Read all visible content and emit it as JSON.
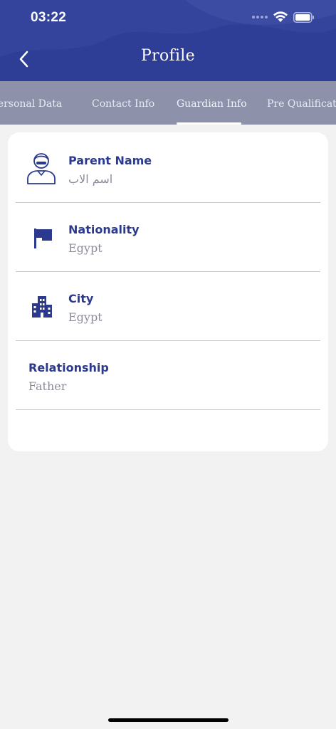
{
  "status_bar": {
    "time": "03:22"
  },
  "header": {
    "title": "Profile"
  },
  "tabs": [
    {
      "label": "Personal Data"
    },
    {
      "label": "Contact Info"
    },
    {
      "label": "Guardian Info",
      "active": true
    },
    {
      "label": "Pre Qualifications"
    }
  ],
  "guardian": {
    "parent_name": {
      "label": "Parent Name",
      "value": "اسم الاب",
      "icon": "user-icon"
    },
    "nationality": {
      "label": "Nationality",
      "value": "Egypt",
      "icon": "flag-icon"
    },
    "city": {
      "label": "City",
      "value": "Egypt",
      "icon": "building-icon"
    },
    "relationship": {
      "label": "Relationship",
      "value": "Father"
    }
  },
  "colors": {
    "header": "#2e3d95",
    "tabs_bg": "#8d92aa",
    "accent": "#2b3a8f",
    "value_text": "#8a8c99",
    "page_bg": "#f2f2f2"
  }
}
